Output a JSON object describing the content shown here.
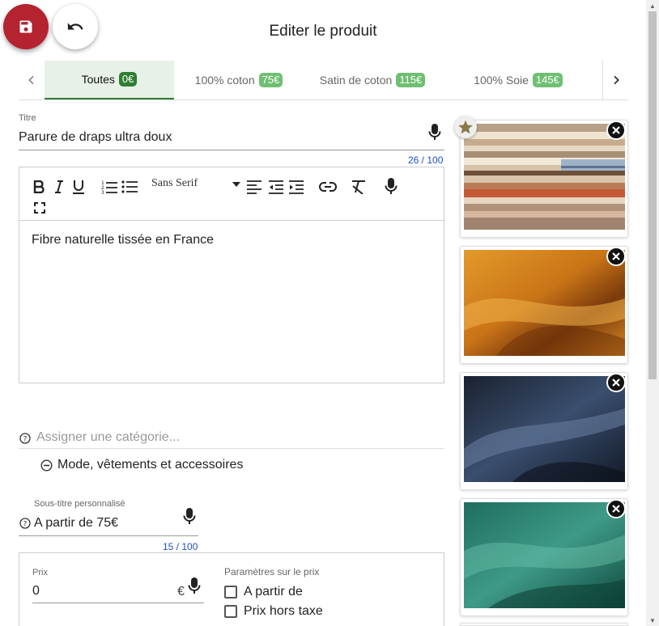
{
  "header": {
    "title": "Editer le produit",
    "save_icon": "save-icon",
    "undo_icon": "undo-icon"
  },
  "tabs": [
    {
      "label": "Toutes",
      "badge": "0€",
      "active": true
    },
    {
      "label": "100% coton",
      "badge": "75€",
      "active": false
    },
    {
      "label": "Satin de coton",
      "badge": "115€",
      "active": false
    },
    {
      "label": "100% Soie",
      "badge": "145€",
      "active": false
    }
  ],
  "title_field": {
    "label": "Titre",
    "value": "Parure de draps ultra doux",
    "counter": "26 / 100"
  },
  "editor": {
    "font": "Sans Serif",
    "content": "Fibre naturelle tissée en France"
  },
  "category": {
    "placeholder": "Assigner une catégorie...",
    "item": "Mode, vêtements et accessoires"
  },
  "subtitle_field": {
    "label": "Sous-titre personnalisé",
    "value": "A partir de 75€",
    "counter": "15 / 100"
  },
  "price": {
    "label": "Prix",
    "value": "0",
    "currency": "€",
    "params_label": "Paramètres sur le prix",
    "options": [
      "A partir de",
      "Prix hors taxe"
    ]
  },
  "images": [
    {
      "name": "beige-folded-linens",
      "starred": true
    },
    {
      "name": "orange-satin-fabric",
      "starred": false
    },
    {
      "name": "navy-silk-fabric",
      "starred": false
    },
    {
      "name": "green-satin-fabric",
      "starred": false
    }
  ],
  "colors": {
    "save": "#b52230",
    "active_tab_bg": "#e8f1e8",
    "badge_active": "#2e7d32",
    "badge": "#6fbf73",
    "counter": "#1e4fc2"
  }
}
